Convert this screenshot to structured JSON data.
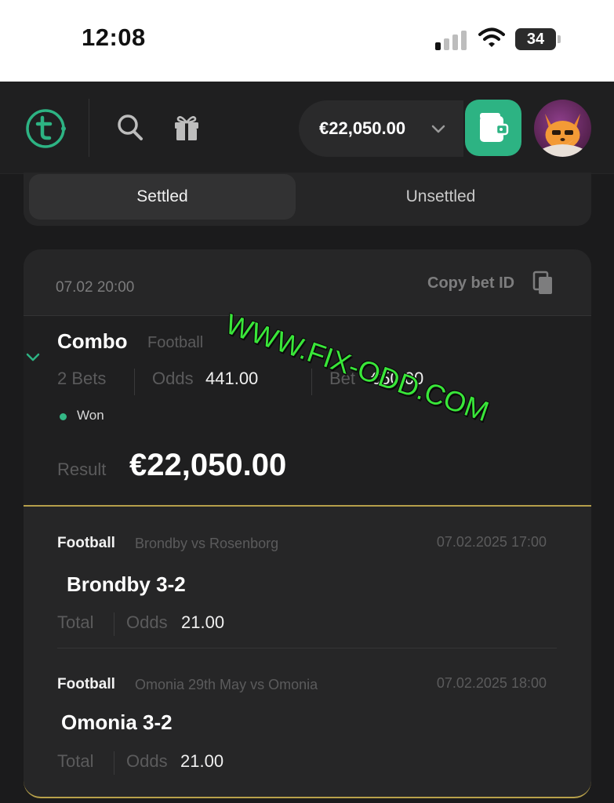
{
  "status_bar": {
    "time": "12:08",
    "battery": "34"
  },
  "header": {
    "logo_icon": "t-logo-icon",
    "balance": "€22,050.00",
    "accent_color": "#2db383"
  },
  "tabs": [
    {
      "label": "Settled",
      "active": true
    },
    {
      "label": "Unsettled",
      "active": false
    }
  ],
  "bet": {
    "date": "07.02 20:00",
    "copy_label": "Copy bet ID",
    "type": "Combo",
    "sport": "Football",
    "bets_count": "2 Bets",
    "odds_label": "Odds",
    "odds_value": "441.00",
    "bet_label": "Bet",
    "bet_value": "€50.00",
    "status": "Won",
    "status_color": "#34b886",
    "result_label": "Result",
    "result_value": "€22,050.00",
    "selections": [
      {
        "sport": "Football",
        "match": "Brondby vs Rosenborg",
        "datetime": "07.02.2025 17:00",
        "pick": "Brondby 3-2",
        "market": "Total",
        "odds_label": "Odds",
        "odds": "21.00"
      },
      {
        "sport": "Football",
        "match": "Omonia 29th May vs Omonia",
        "datetime": "07.02.2025 18:00",
        "pick": "Omonia 3-2",
        "market": "Total",
        "odds_label": "Odds",
        "odds": "21.00"
      }
    ]
  },
  "watermark": "WWW.FIX-ODD.COM"
}
